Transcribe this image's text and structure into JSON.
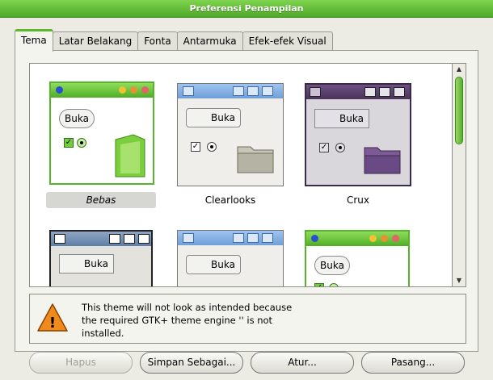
{
  "window": {
    "title": "Preferensi Penampilan"
  },
  "tabs": [
    "Tema",
    "Latar Belakang",
    "Fonta",
    "Antarmuka",
    "Efek-efek Visual"
  ],
  "themes": [
    {
      "name": "Bebas",
      "selected": true,
      "button": "Buka"
    },
    {
      "name": "Clearlooks",
      "selected": false,
      "button": "Buka"
    },
    {
      "name": "Crux",
      "selected": false,
      "button": "Buka"
    },
    {
      "name": "",
      "selected": false,
      "button": "Buka"
    },
    {
      "name": "",
      "selected": false,
      "button": "Buka"
    },
    {
      "name": "",
      "selected": false,
      "button": "Buka"
    }
  ],
  "warning": {
    "icon": "warning-triangle-icon",
    "text": "This theme will not look as intended because\nthe required GTK+ theme engine '' is not\ninstalled."
  },
  "buttons": {
    "remove": "Hapus",
    "save_as": "Simpan Sebagai...",
    "customize": "Atur...",
    "install": "Pasang..."
  },
  "colors": {
    "accent_green": "#5ab82a",
    "clearlooks_blue": "#6f9fd8",
    "crux_purple": "#5a3f6e"
  }
}
